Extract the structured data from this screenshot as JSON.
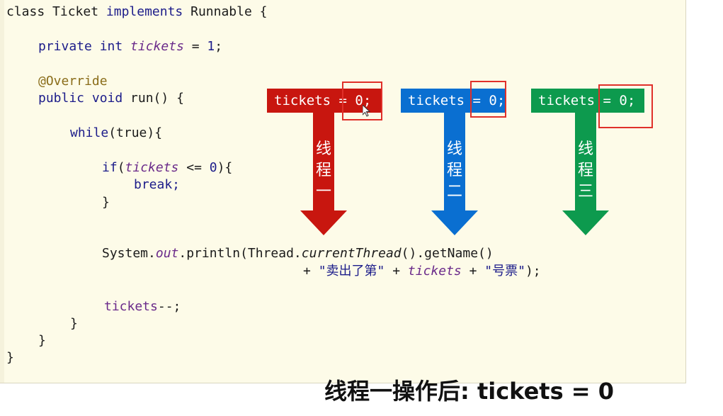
{
  "code": {
    "l1_a": "class Ticket ",
    "l1_b": "implements",
    "l1_c": " Runnable {",
    "l2_kw": "private int ",
    "l2_field": "tickets",
    "l2_rest": " = ",
    "l2_num": "1",
    "l2_end": ";",
    "l3": "@Override",
    "l4_kw": "public void ",
    "l4_rest": "run() {",
    "l5_kw": "while",
    "l5_rest": "(true){",
    "l6_kw": "if",
    "l6_a": "(",
    "l6_field": "tickets",
    "l6_b": " <= ",
    "l6_num": "0",
    "l6_c": "){",
    "l7": "break;",
    "l8": "}",
    "l9_a": "System.",
    "l9_out": "out",
    "l9_b": ".println(Thread.",
    "l9_ct": "currentThread",
    "l9_c": "().getName()",
    "l10_a": "+ ",
    "l10_s1": "\"卖出了第\"",
    "l10_b": " + ",
    "l10_field": "tickets",
    "l10_c": " + ",
    "l10_s2": "\"号票\"",
    "l10_d": ");",
    "l11_field": "tickets",
    "l11_rest": "--;",
    "l12": "}",
    "l13": "}",
    "l14": "}"
  },
  "threads": [
    {
      "box_text": "tickets = 0;",
      "label": [
        "线",
        "程",
        "一"
      ],
      "color": "#c8160f"
    },
    {
      "box_text": "tickets = 0;",
      "label": [
        "线",
        "程",
        "二"
      ],
      "color": "#0a6fd1"
    },
    {
      "box_text": "tickets = 0;",
      "label": [
        "线",
        "程",
        "三"
      ],
      "color": "#0d9a4e"
    }
  ],
  "caption": "线程一操作后: tickets = 0",
  "colors": {
    "highlight": "#e0302a",
    "slide_bg": "#fdfbe8"
  }
}
